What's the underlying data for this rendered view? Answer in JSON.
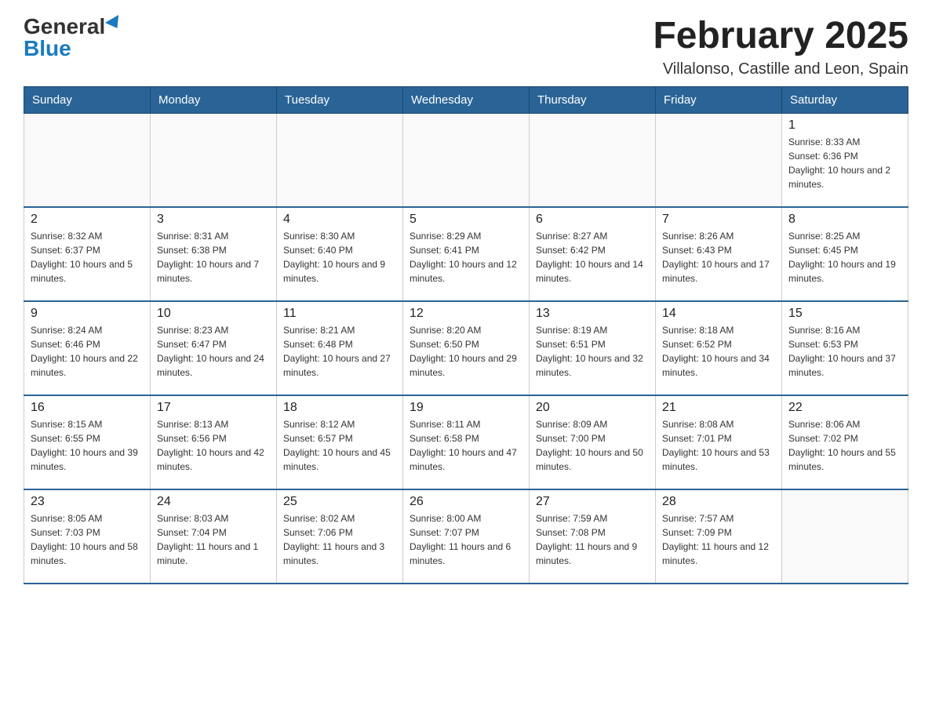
{
  "header": {
    "logo_general": "General",
    "logo_blue": "Blue",
    "title": "February 2025",
    "subtitle": "Villalonso, Castille and Leon, Spain"
  },
  "days_of_week": [
    "Sunday",
    "Monday",
    "Tuesday",
    "Wednesday",
    "Thursday",
    "Friday",
    "Saturday"
  ],
  "weeks": [
    [
      {
        "day": "",
        "info": ""
      },
      {
        "day": "",
        "info": ""
      },
      {
        "day": "",
        "info": ""
      },
      {
        "day": "",
        "info": ""
      },
      {
        "day": "",
        "info": ""
      },
      {
        "day": "",
        "info": ""
      },
      {
        "day": "1",
        "info": "Sunrise: 8:33 AM\nSunset: 6:36 PM\nDaylight: 10 hours and 2 minutes."
      }
    ],
    [
      {
        "day": "2",
        "info": "Sunrise: 8:32 AM\nSunset: 6:37 PM\nDaylight: 10 hours and 5 minutes."
      },
      {
        "day": "3",
        "info": "Sunrise: 8:31 AM\nSunset: 6:38 PM\nDaylight: 10 hours and 7 minutes."
      },
      {
        "day": "4",
        "info": "Sunrise: 8:30 AM\nSunset: 6:40 PM\nDaylight: 10 hours and 9 minutes."
      },
      {
        "day": "5",
        "info": "Sunrise: 8:29 AM\nSunset: 6:41 PM\nDaylight: 10 hours and 12 minutes."
      },
      {
        "day": "6",
        "info": "Sunrise: 8:27 AM\nSunset: 6:42 PM\nDaylight: 10 hours and 14 minutes."
      },
      {
        "day": "7",
        "info": "Sunrise: 8:26 AM\nSunset: 6:43 PM\nDaylight: 10 hours and 17 minutes."
      },
      {
        "day": "8",
        "info": "Sunrise: 8:25 AM\nSunset: 6:45 PM\nDaylight: 10 hours and 19 minutes."
      }
    ],
    [
      {
        "day": "9",
        "info": "Sunrise: 8:24 AM\nSunset: 6:46 PM\nDaylight: 10 hours and 22 minutes."
      },
      {
        "day": "10",
        "info": "Sunrise: 8:23 AM\nSunset: 6:47 PM\nDaylight: 10 hours and 24 minutes."
      },
      {
        "day": "11",
        "info": "Sunrise: 8:21 AM\nSunset: 6:48 PM\nDaylight: 10 hours and 27 minutes."
      },
      {
        "day": "12",
        "info": "Sunrise: 8:20 AM\nSunset: 6:50 PM\nDaylight: 10 hours and 29 minutes."
      },
      {
        "day": "13",
        "info": "Sunrise: 8:19 AM\nSunset: 6:51 PM\nDaylight: 10 hours and 32 minutes."
      },
      {
        "day": "14",
        "info": "Sunrise: 8:18 AM\nSunset: 6:52 PM\nDaylight: 10 hours and 34 minutes."
      },
      {
        "day": "15",
        "info": "Sunrise: 8:16 AM\nSunset: 6:53 PM\nDaylight: 10 hours and 37 minutes."
      }
    ],
    [
      {
        "day": "16",
        "info": "Sunrise: 8:15 AM\nSunset: 6:55 PM\nDaylight: 10 hours and 39 minutes."
      },
      {
        "day": "17",
        "info": "Sunrise: 8:13 AM\nSunset: 6:56 PM\nDaylight: 10 hours and 42 minutes."
      },
      {
        "day": "18",
        "info": "Sunrise: 8:12 AM\nSunset: 6:57 PM\nDaylight: 10 hours and 45 minutes."
      },
      {
        "day": "19",
        "info": "Sunrise: 8:11 AM\nSunset: 6:58 PM\nDaylight: 10 hours and 47 minutes."
      },
      {
        "day": "20",
        "info": "Sunrise: 8:09 AM\nSunset: 7:00 PM\nDaylight: 10 hours and 50 minutes."
      },
      {
        "day": "21",
        "info": "Sunrise: 8:08 AM\nSunset: 7:01 PM\nDaylight: 10 hours and 53 minutes."
      },
      {
        "day": "22",
        "info": "Sunrise: 8:06 AM\nSunset: 7:02 PM\nDaylight: 10 hours and 55 minutes."
      }
    ],
    [
      {
        "day": "23",
        "info": "Sunrise: 8:05 AM\nSunset: 7:03 PM\nDaylight: 10 hours and 58 minutes."
      },
      {
        "day": "24",
        "info": "Sunrise: 8:03 AM\nSunset: 7:04 PM\nDaylight: 11 hours and 1 minute."
      },
      {
        "day": "25",
        "info": "Sunrise: 8:02 AM\nSunset: 7:06 PM\nDaylight: 11 hours and 3 minutes."
      },
      {
        "day": "26",
        "info": "Sunrise: 8:00 AM\nSunset: 7:07 PM\nDaylight: 11 hours and 6 minutes."
      },
      {
        "day": "27",
        "info": "Sunrise: 7:59 AM\nSunset: 7:08 PM\nDaylight: 11 hours and 9 minutes."
      },
      {
        "day": "28",
        "info": "Sunrise: 7:57 AM\nSunset: 7:09 PM\nDaylight: 11 hours and 12 minutes."
      },
      {
        "day": "",
        "info": ""
      }
    ]
  ]
}
